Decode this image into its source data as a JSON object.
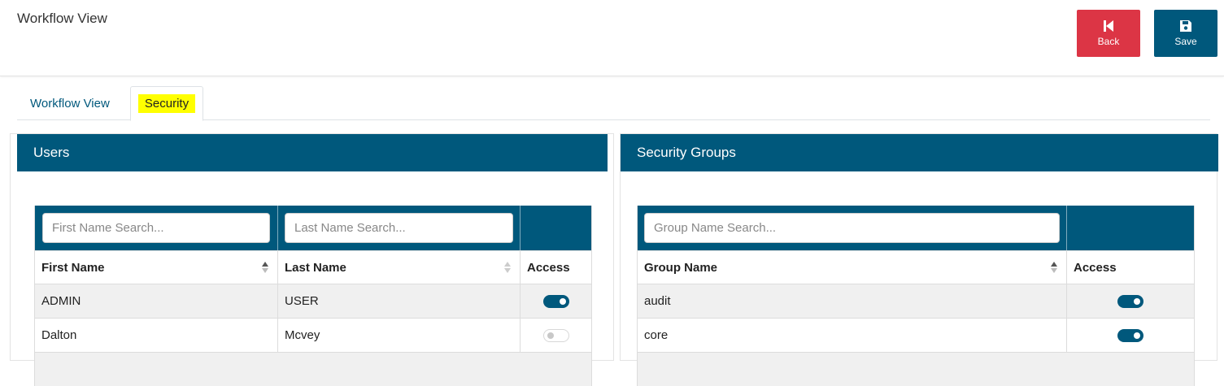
{
  "page": {
    "title": "Workflow View",
    "back_label": "Back",
    "save_label": "Save"
  },
  "tabs": [
    {
      "label": "Workflow View",
      "active": false
    },
    {
      "label": "Security",
      "active": true
    }
  ],
  "users": {
    "title": "Users",
    "first_name_placeholder": "First Name Search...",
    "last_name_placeholder": "Last Name Search...",
    "columns": [
      "First Name",
      "Last Name",
      "Access"
    ],
    "rows": [
      {
        "first_name": "ADMIN",
        "last_name": "USER",
        "access": true
      },
      {
        "first_name": "Dalton",
        "last_name": "Mcvey",
        "access": false
      }
    ]
  },
  "groups": {
    "title": "Security Groups",
    "group_name_placeholder": "Group Name Search...",
    "columns": [
      "Group Name",
      "Access"
    ],
    "rows": [
      {
        "group_name": "audit",
        "access": true
      },
      {
        "group_name": "core",
        "access": true
      }
    ]
  },
  "colors": {
    "primary": "#00587c",
    "danger": "#dc3545",
    "highlight": "#ffff00"
  },
  "icons": [
    "step-backward-icon",
    "save-icon",
    "sort-icon"
  ]
}
